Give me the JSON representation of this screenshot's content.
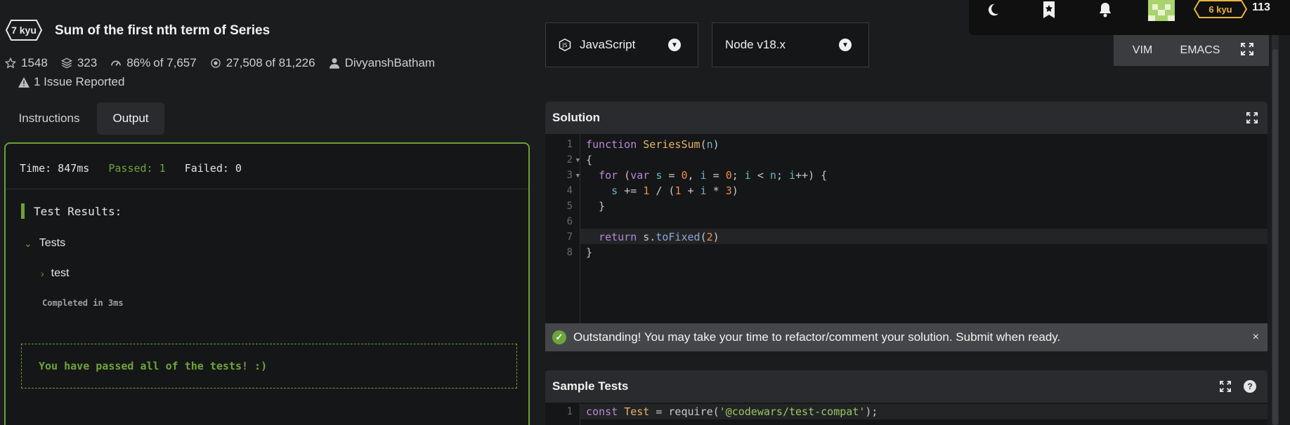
{
  "topnav": {
    "theme_icon": "moon-icon",
    "bookmark_icon": "bookmark-star-icon",
    "notification_icon": "bell-icon",
    "avatar_icon": "avatar",
    "rank": "6 kyu",
    "honor": "113"
  },
  "kata": {
    "kyu": "7 kyu",
    "title": "Sum of the first nth term of Series",
    "stars": "1548",
    "collections": "323",
    "satisfaction": "86%",
    "satisfaction_of": "of 7,657",
    "completed": "27,508",
    "completed_of": "of 81,226",
    "author": "DivyanshBatham",
    "issues": "1 Issue Reported"
  },
  "tabs": {
    "instructions": "Instructions",
    "output": "Output"
  },
  "output": {
    "time": "Time: 847ms",
    "passed": "Passed: 1",
    "failed": "Failed: 0",
    "results_heading": "Test Results:",
    "group": "Tests",
    "test": "test",
    "completed_in": "Completed in 3ms",
    "all_passed": "You have passed all of the tests! :)"
  },
  "language_select": {
    "label": "JavaScript"
  },
  "version_select": {
    "label": "Node v18.x"
  },
  "modes": {
    "vim": "VIM",
    "emacs": "EMACS"
  },
  "solution": {
    "title": "Solution",
    "line_numbers": [
      "1",
      "2",
      "3",
      "4",
      "5",
      "6",
      "7",
      "8"
    ]
  },
  "banner": {
    "message": "Outstanding! You may take your time to refactor/comment your solution. Submit when ready.",
    "close": "×"
  },
  "sample_tests": {
    "title": "Sample Tests",
    "help": "?",
    "line_numbers": [
      "1"
    ]
  },
  "colors": {
    "accent_green": "#6e9f38",
    "rank_yellow": "#e8b53f"
  }
}
